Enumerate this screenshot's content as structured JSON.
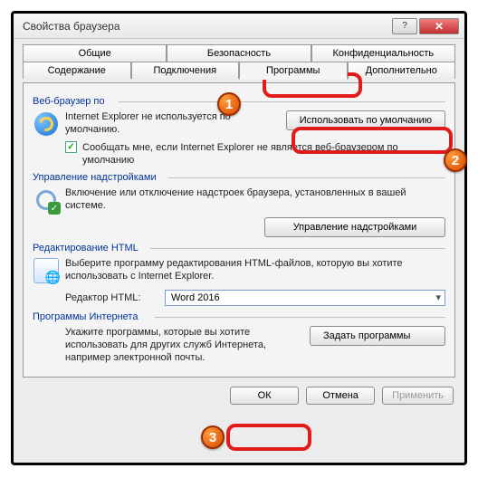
{
  "window": {
    "title": "Свойства браузера"
  },
  "tabs": {
    "row1": [
      "Общие",
      "Безопасность",
      "Конфиденциальность"
    ],
    "row2": [
      "Содержание",
      "Подключения",
      "Программы",
      "Дополнительно"
    ],
    "active": "Программы"
  },
  "groups": {
    "browser": {
      "label": "Веб-браузер по",
      "text": "Internet Explorer не используется по умолчанию.",
      "button": "Использовать по умолчанию",
      "checkbox": "Сообщать мне, если Internet Explorer не является веб-браузером по умолчанию"
    },
    "addons": {
      "label": "Управление надстройками",
      "text": "Включение или отключение надстроек браузера, установленных в вашей системе.",
      "button": "Управление надстройками"
    },
    "html": {
      "label": "Редактирование HTML",
      "text": "Выберите программу редактирования HTML-файлов, которую вы хотите использовать с Internet Explorer.",
      "field_label": "Редактор HTML:",
      "field_value": "Word 2016"
    },
    "programs": {
      "label": "Программы Интернета",
      "text": "Укажите программы, которые вы хотите использовать для других служб Интернета, например электронной почты.",
      "button": "Задать программы"
    }
  },
  "footer": {
    "ok": "ОК",
    "cancel": "Отмена",
    "apply": "Применить"
  },
  "badges": {
    "b1": "1",
    "b2": "2",
    "b3": "3"
  }
}
